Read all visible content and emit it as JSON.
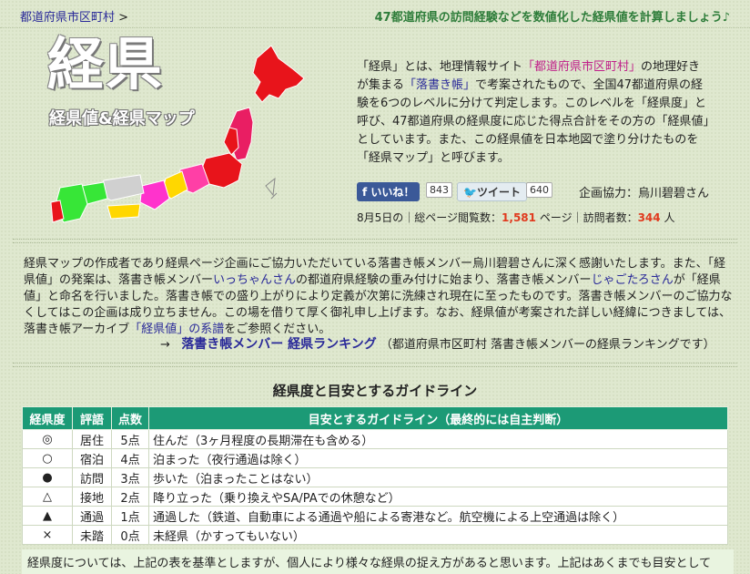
{
  "header": {
    "breadcrumb_link": "都道府県市区町村",
    "breadcrumb_sep": ">",
    "tagline": "47都道府県の訪問経験などを数値化した経県値を計算しましょう♪"
  },
  "logo": {
    "title": "経県",
    "subtitle": "経県値&経県マップ"
  },
  "intro": {
    "p1": "「経県」とは、地理情報サイト",
    "link1": "「都道府県市区町村」",
    "p2": "の地理好きが集まる",
    "link2": "「落書き帳」",
    "p3": "で考案されたもので、全国47都道府県の経験を6つのレベルに分けて判定します。このレベルを「経県度」と呼び、47都道府県の経県度に応じた得点合計をその方の「経県値」としています。また、この経県値を日本地図で塗り分けたものを「経県マップ」と呼びます。"
  },
  "social": {
    "like_label": "いいね！",
    "like_count": "843",
    "tweet_label": "ツイート",
    "tweet_count": "640",
    "cooperation": "企画協力：烏川碧碧さん"
  },
  "stats": {
    "prefix": "8月5日の｜総ページ閲覧数：",
    "pageviews": "1,581",
    "mid": " ページ｜訪問者数：",
    "visitors": "344",
    "suffix": " 人"
  },
  "thanks": {
    "t1": "経県マップの作成者であり経県ページ企画にご協力いただいている落書き帳メンバー烏川碧碧さんに深く感謝いたします。また、「経県値」の発案は、落書き帳メンバー",
    "l1": "いっちゃんさん",
    "t2": "の都道府県経験の重み付けに始まり、落書き帳メンバー",
    "l2": "じゃごたろさん",
    "t3": "が「経県値」と命名を行いました。落書き帳での盛り上がりにより定義が次第に洗練され現在に至ったものです。落書き帳メンバーのご協力なくしてはこの企画は成り立ちません。この場を借りて厚く御礼申し上げます。なお、経県値が考案された詳しい経緯につきましては、落書き帳アーカイブ",
    "l3": "「経県値」の系譜",
    "t4": "をご参照ください。"
  },
  "ranking": {
    "arrow": "→",
    "link": "落書き帳メンバー 経県ランキング",
    "note": "（都道府県市区町村 落書き帳メンバーの経県ランキングです）"
  },
  "guide": {
    "title": "経県度と目安とするガイドライン",
    "headers": [
      "経県度",
      "評語",
      "点数",
      "目安とするガイドライン（最終的には自主判断）"
    ],
    "rows": [
      [
        "◎",
        "居住",
        "5点",
        "住んだ（3ヶ月程度の長期滞在も含める）"
      ],
      [
        "○",
        "宿泊",
        "4点",
        "泊まった（夜行通過は除く）"
      ],
      [
        "●",
        "訪問",
        "3点",
        "歩いた（泊まったことはない）"
      ],
      [
        "△",
        "接地",
        "2点",
        "降り立った（乗り換えやSA/PAでの休憩など）"
      ],
      [
        "▲",
        "通過",
        "1点",
        "通過した（鉄道、自動車による通過や船による寄港など。航空機による上空通過は除く）"
      ],
      [
        "×",
        "未踏",
        "0点",
        "未経県（かすってもいない）"
      ]
    ],
    "note": "経県度については、上記の表を基準としますが、個人により様々な経県の捉え方があると思います。上記はあくまでも目安として"
  },
  "colors": {
    "header_green": "#1c9a76",
    "accent_red": "#e03a1e",
    "link_blue": "#2a2a99",
    "tagline_green": "#2e7d3a"
  }
}
